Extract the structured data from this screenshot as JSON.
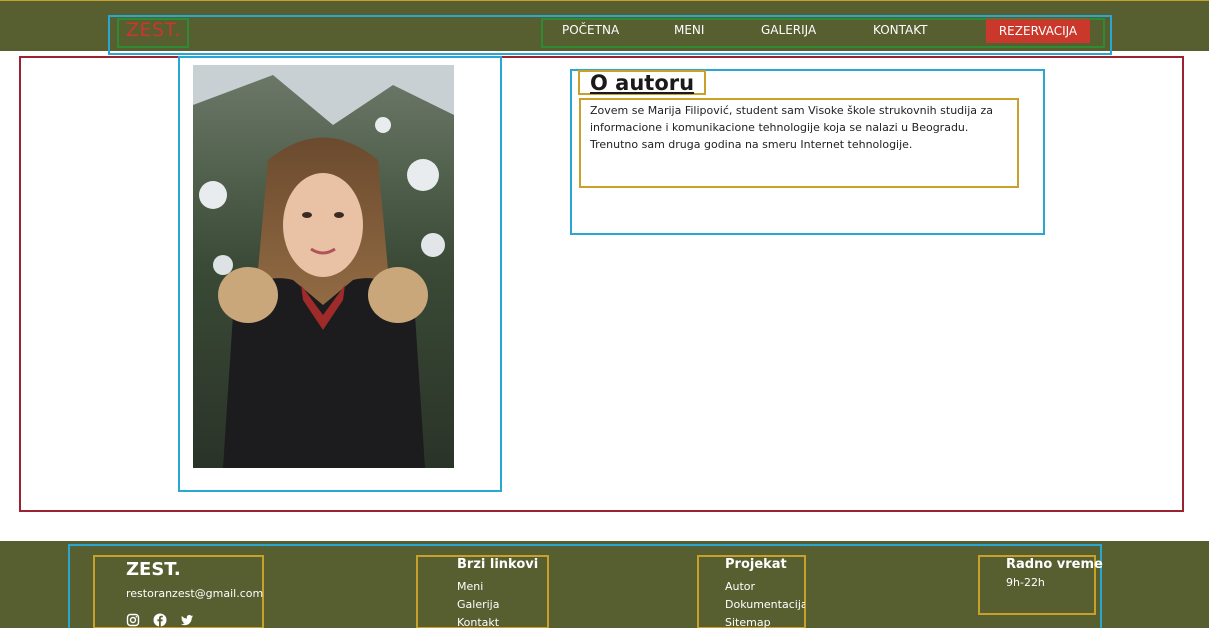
{
  "header": {
    "logo": "ZEST.",
    "nav": [
      "POČETNA",
      "MENI",
      "GALERIJA",
      "KONTAKT"
    ],
    "cta": "REZERVACIJA"
  },
  "about": {
    "title": "O autoru",
    "bio": "Zovem se Marija Filipović, student sam Visoke škole strukovnih studija za informacione i komunikacione tehnologije koja se nalazi u Beogradu. Trenutno sam druga godina na smeru Internet tehnologije."
  },
  "footer": {
    "brand": "ZEST.",
    "email": "restoranzest@gmail.com",
    "social": [
      "instagram-icon",
      "facebook-icon",
      "twitter-icon"
    ],
    "quick_links": {
      "heading": "Brzi linkovi",
      "items": [
        "Meni",
        "Galerija",
        "Kontakt"
      ]
    },
    "project": {
      "heading": "Projekat",
      "items": [
        "Autor",
        "Dokumentacija",
        "Sitemap"
      ]
    },
    "hours": {
      "heading": "Radno vreme",
      "value": "9h-22h"
    }
  },
  "colors": {
    "header_bg": "#575e30",
    "accent": "#c9382a"
  }
}
